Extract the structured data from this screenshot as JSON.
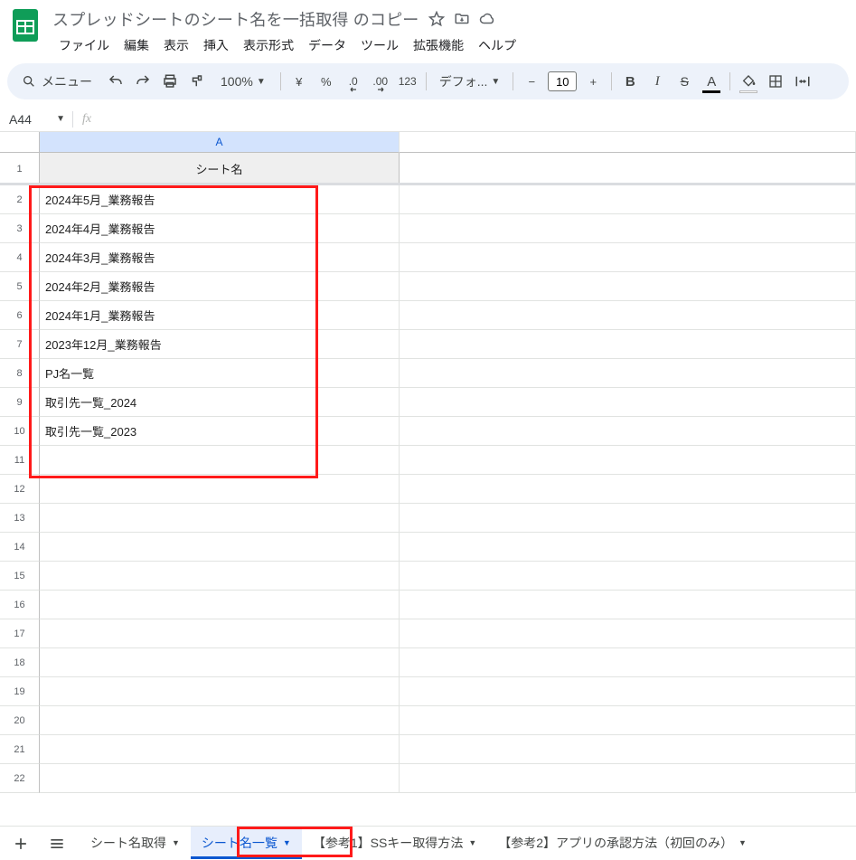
{
  "header": {
    "doc_title": "スプレッドシートのシート名を一括取得 のコピー",
    "menu": [
      "ファイル",
      "編集",
      "表示",
      "挿入",
      "表示形式",
      "データ",
      "ツール",
      "拡張機能",
      "ヘルプ"
    ]
  },
  "toolbar": {
    "menu_label": "メニュー",
    "zoom": "100%",
    "currency": "¥",
    "percent": "%",
    "dec_dec": ".0",
    "inc_dec": ".00",
    "numfmt": "123",
    "font": "デフォ...",
    "font_size": "10",
    "bold": "B",
    "italic": "I",
    "strike": "S",
    "textcolor": "A"
  },
  "namebox": {
    "ref": "A44",
    "fx": "fx"
  },
  "grid": {
    "col_a_label": "A",
    "header_cell": "シート名",
    "rows": [
      "2024年5月_業務報告",
      "2024年4月_業務報告",
      "2024年3月_業務報告",
      "2024年2月_業務報告",
      "2024年1月_業務報告",
      "2023年12月_業務報告",
      "PJ名一覧",
      "取引先一覧_2024",
      "取引先一覧_2023"
    ],
    "row_numbers": [
      "1",
      "2",
      "3",
      "4",
      "5",
      "6",
      "7",
      "8",
      "9",
      "10",
      "11",
      "12",
      "13",
      "14",
      "15",
      "16",
      "17",
      "18",
      "19",
      "20",
      "21",
      "22"
    ]
  },
  "footer": {
    "tabs": [
      "シート名取得",
      "シート名一覧",
      "【参考1】SSキー取得方法",
      "【参考2】アプリの承認方法（初回のみ）"
    ],
    "active_index": 1
  }
}
